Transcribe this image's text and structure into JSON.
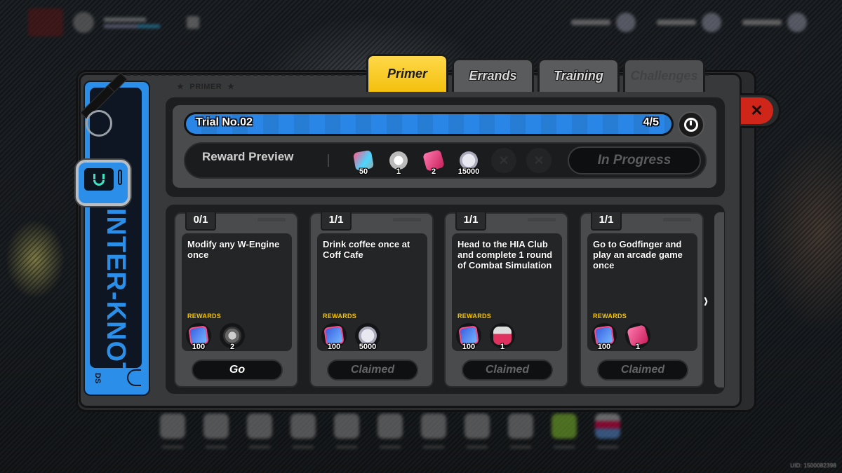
{
  "tabs": [
    {
      "label": "Primer",
      "active": true
    },
    {
      "label": "Errands",
      "active": false
    },
    {
      "label": "Training",
      "active": false
    },
    {
      "label": "Challenges",
      "active": false,
      "locked": true
    }
  ],
  "section_caption": "PRIMER",
  "close_icon": "close-icon",
  "strap": {
    "brand_text": "INTER-KNOT",
    "small_text": "DS"
  },
  "trial": {
    "title": "Trial No.02",
    "progress_text": "4/5",
    "progress": {
      "current": 4,
      "total": 5
    },
    "timer_icon": "timer-icon"
  },
  "reward_preview": {
    "label": "Reward Preview",
    "items": [
      {
        "icon": "film-ticket-icon",
        "qty": "50"
      },
      {
        "icon": "film-reel-icon",
        "qty": "1"
      },
      {
        "icon": "pink-material-icon",
        "qty": "2"
      },
      {
        "icon": "dennies-coin-icon",
        "qty": "15000"
      },
      {
        "icon": "empty-slot-icon",
        "qty": ""
      },
      {
        "icon": "empty-slot-icon",
        "qty": ""
      }
    ],
    "status": "In Progress"
  },
  "tasks": [
    {
      "progress": "0/1",
      "description": "Modify any W-Engine once",
      "rewards_label": "REWARDS",
      "rewards": [
        {
          "icon": "inter-knot-book-icon",
          "qty": "100"
        },
        {
          "icon": "w-engine-component-icon",
          "qty": "2"
        }
      ],
      "button": "Go",
      "claimed": false
    },
    {
      "progress": "1/1",
      "description": "Drink coffee once at Coff Cafe",
      "rewards_label": "REWARDS",
      "rewards": [
        {
          "icon": "inter-knot-book-icon",
          "qty": "100"
        },
        {
          "icon": "dennies-coin-icon",
          "qty": "5000"
        }
      ],
      "button": "Claimed",
      "claimed": true
    },
    {
      "progress": "1/1",
      "description": "Head to the HIA Club and complete 1 round of Combat Simulation",
      "rewards_label": "REWARDS",
      "rewards": [
        {
          "icon": "inter-knot-book-icon",
          "qty": "100"
        },
        {
          "icon": "battery-car-icon",
          "qty": "1"
        }
      ],
      "button": "Claimed",
      "claimed": true
    },
    {
      "progress": "1/1",
      "description": "Go to Godfinger and play an arcade game once",
      "rewards_label": "REWARDS",
      "rewards": [
        {
          "icon": "inter-knot-book-icon",
          "qty": "100"
        },
        {
          "icon": "pink-material-icon",
          "qty": "1"
        }
      ],
      "button": "Claimed",
      "claimed": true
    }
  ],
  "next_arrow": "›",
  "uid": "UID: 1500082398"
}
